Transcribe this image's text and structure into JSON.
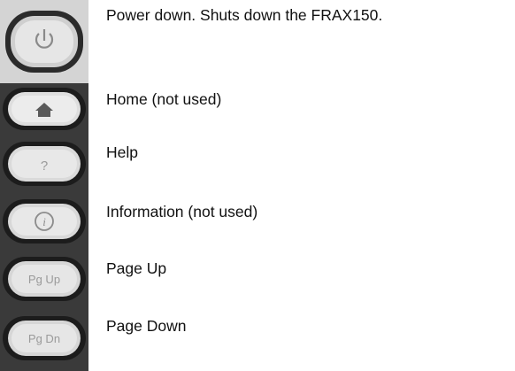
{
  "buttons": [
    {
      "icon": "power-icon",
      "key_label": "",
      "description": "Power down. Shuts down the FRAX150."
    },
    {
      "icon": "home-icon",
      "key_label": "",
      "description": "Home (not used)"
    },
    {
      "icon": "help-icon",
      "key_label": "?",
      "description": "Help"
    },
    {
      "icon": "info-icon",
      "key_label": "i",
      "description": "Information (not used)"
    },
    {
      "icon": "page-up-icon",
      "key_label": "Pg Up",
      "description": "Page Up"
    },
    {
      "icon": "page-down-icon",
      "key_label": "Pg Dn",
      "description": "Page Down"
    }
  ]
}
